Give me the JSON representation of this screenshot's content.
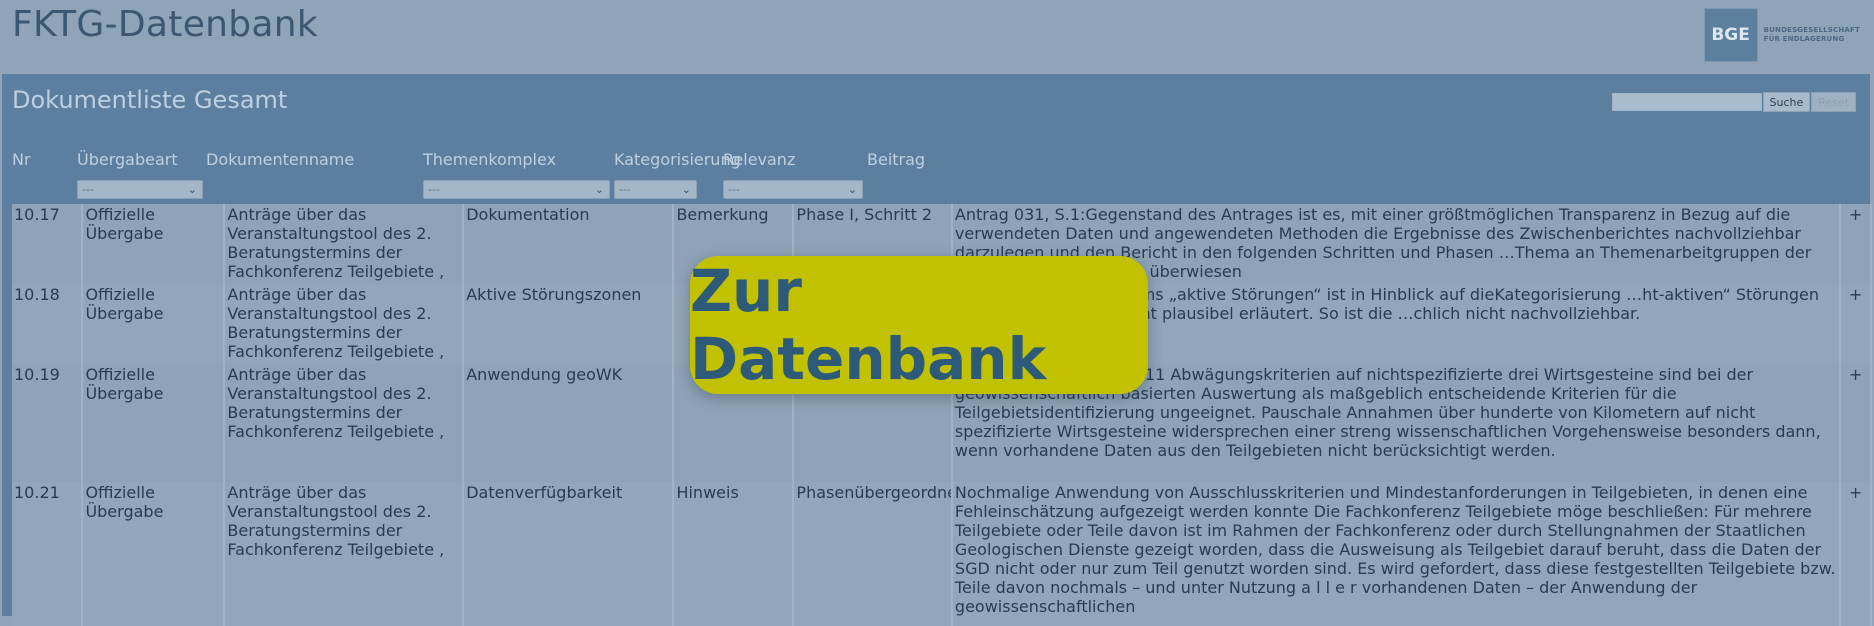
{
  "header": {
    "app_title": "FKTG-Datenbank",
    "logo": {
      "mark": "BGE",
      "line1": "BUNDESGESELLSCHAFT",
      "line2": "FÜR ENDLAGERUNG"
    }
  },
  "panel": {
    "title": "Dokumentliste Gesamt",
    "search": {
      "value": "",
      "button": "Suche",
      "reset": "Reset"
    }
  },
  "columns": {
    "nr": "Nr",
    "uebergabeart": "Übergabeart",
    "dokumentenname": "Dokumentenname",
    "themenkomplex": "Themenkomplex",
    "kategorisierung": "Kategorisierung",
    "relevanz": "Relevanz",
    "beitrag": "Beitrag"
  },
  "filters": {
    "uebergabeart": "---",
    "themenkomplex": "---",
    "kategorisierung": "---",
    "relevanz": "---"
  },
  "rows": [
    {
      "nr": "10.17",
      "uebergabeart": "Offizielle Übergabe",
      "dokumentenname": "Anträge über das Veranstaltungstool des 2. Beratungstermins der Fachkonferenz Teilgebiete ,",
      "themenkomplex": "Dokumentation",
      "kategorisierung": "Bemerkung",
      "relevanz": "Phase I, Schritt 2",
      "beitrag": "Antrag 031, S.1:Gegenstand des Antrages ist es, mit einer größtmöglichen Transparenz in Bezug auf die verwendeten Daten und angewendeten Methoden die Ergebnisse des Zwischenberichtes nachvollziehbar darzulegen und den Bericht in den folgenden Schritten und Phasen …Thema an Themenarbeitgruppen der FKTG zu Wirtsgesteinen überwiesen",
      "expand": "+"
    },
    {
      "nr": "10.18",
      "uebergabeart": "Offizielle Übergabe",
      "dokumentenname": "Anträge über das Veranstaltungstool des 2. Beratungstermins der Fachkonferenz Teilgebiete ,",
      "themenkomplex": "Aktive Störungszonen",
      "kategorisierung": "",
      "relevanz": "",
      "beitrag": "…es Ausschlusskriteriums „aktive Störungen“ ist in Hinblick auf dieKategorisierung …ht-aktiven“ Störungen im Zwischenbericht nicht plausibel erläutert. So ist die …chlich nicht nachvollziehbar.",
      "expand": "+"
    },
    {
      "nr": "10.19",
      "uebergabeart": "Offizielle Übergabe",
      "dokumentenname": "Anträge über das Veranstaltungstool des 2. Beratungstermins der Fachkonferenz Teilgebiete ,",
      "themenkomplex": "Anwendung geoWK",
      "kategorisierung": "",
      "relevanz": "",
      "beitrag": "…wendung bei 7-9 von 11 Abwägungskriterien auf nichtspezifizierte drei Wirtsgesteine sind bei der geowissenschaftlich basierten Auswertung als maßgeblich entscheidende Kriterien für die Teilgebietsidentifizierung ungeeignet. Pauschale Annahmen über hunderte von Kilometern auf nicht spezifizierte Wirtsgesteine widersprechen einer streng wissenschaftlichen Vorgehensweise besonders dann, wenn vorhandene Daten aus den Teilgebieten nicht berücksichtigt werden.",
      "expand": "+"
    },
    {
      "nr": "10.21",
      "uebergabeart": "Offizielle Übergabe",
      "dokumentenname": "Anträge über das Veranstaltungstool des 2. Beratungstermins der Fachkonferenz Teilgebiete ,",
      "themenkomplex": "Datenverfügbarkeit",
      "kategorisierung": "Hinweis",
      "relevanz": "Phasenübergeordnet",
      "beitrag": "Nochmalige Anwendung von Ausschlusskriterien und Mindestanforderungen in Teilgebieten, in denen eine Fehleinschätzung aufgezeigt werden konnte Die Fachkonferenz Teilgebiete möge beschließen: Für mehrere Teilgebiete oder Teile davon ist im Rahmen der Fachkonferenz oder durch Stellungnahmen der Staatlichen Geologischen Dienste gezeigt worden, dass die Ausweisung als Teilgebiet darauf beruht, dass die Daten der SGD nicht oder nur zum Teil genutzt worden sind. Es wird gefordert, dass diese festgestellten Teilgebiete bzw. Teile davon nochmals – und unter Nutzung a l l e r vorhandenen Daten – der Anwendung der geowissenschaftlichen",
      "expand": "+"
    }
  ],
  "cta": {
    "label": "Zur Datenbank"
  }
}
